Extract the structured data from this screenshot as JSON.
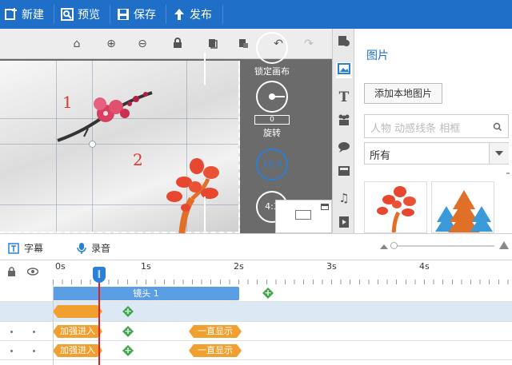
{
  "toolbar": {
    "new_label": "新建",
    "preview_label": "预览",
    "save_label": "保存",
    "publish_label": "发布"
  },
  "stage": {
    "label_1": "1",
    "label_2": "2"
  },
  "controls": {
    "lock_canvas_label": "锁定画布",
    "rotate_value": "0",
    "rotate_label": "旋转",
    "ratio_169": "16:9",
    "ratio_43": "4:3"
  },
  "panel": {
    "title": "图片",
    "add_local_button": "添加本地图片",
    "search_placeholder": "人物 动感线条 相框",
    "filter_selected": "所有"
  },
  "timeline": {
    "subtitle_label": "字幕",
    "record_label": "录音",
    "ticks": [
      "0s",
      "1s",
      "2s",
      "3s",
      "4s"
    ],
    "scene_label": "镜头 1",
    "row2_chip1": "加强进入",
    "row2_chip2": "一直显示",
    "row3_chip1": "加强进入",
    "row3_chip2": "一直显示",
    "playhead_icon": "pause-icon"
  },
  "colors": {
    "brand_blue": "#1f6fc8",
    "timeline_blue": "#5b9ee6",
    "chip_orange": "#f1a030",
    "add_green": "#3da84b",
    "playhead_red": "#e02020"
  }
}
